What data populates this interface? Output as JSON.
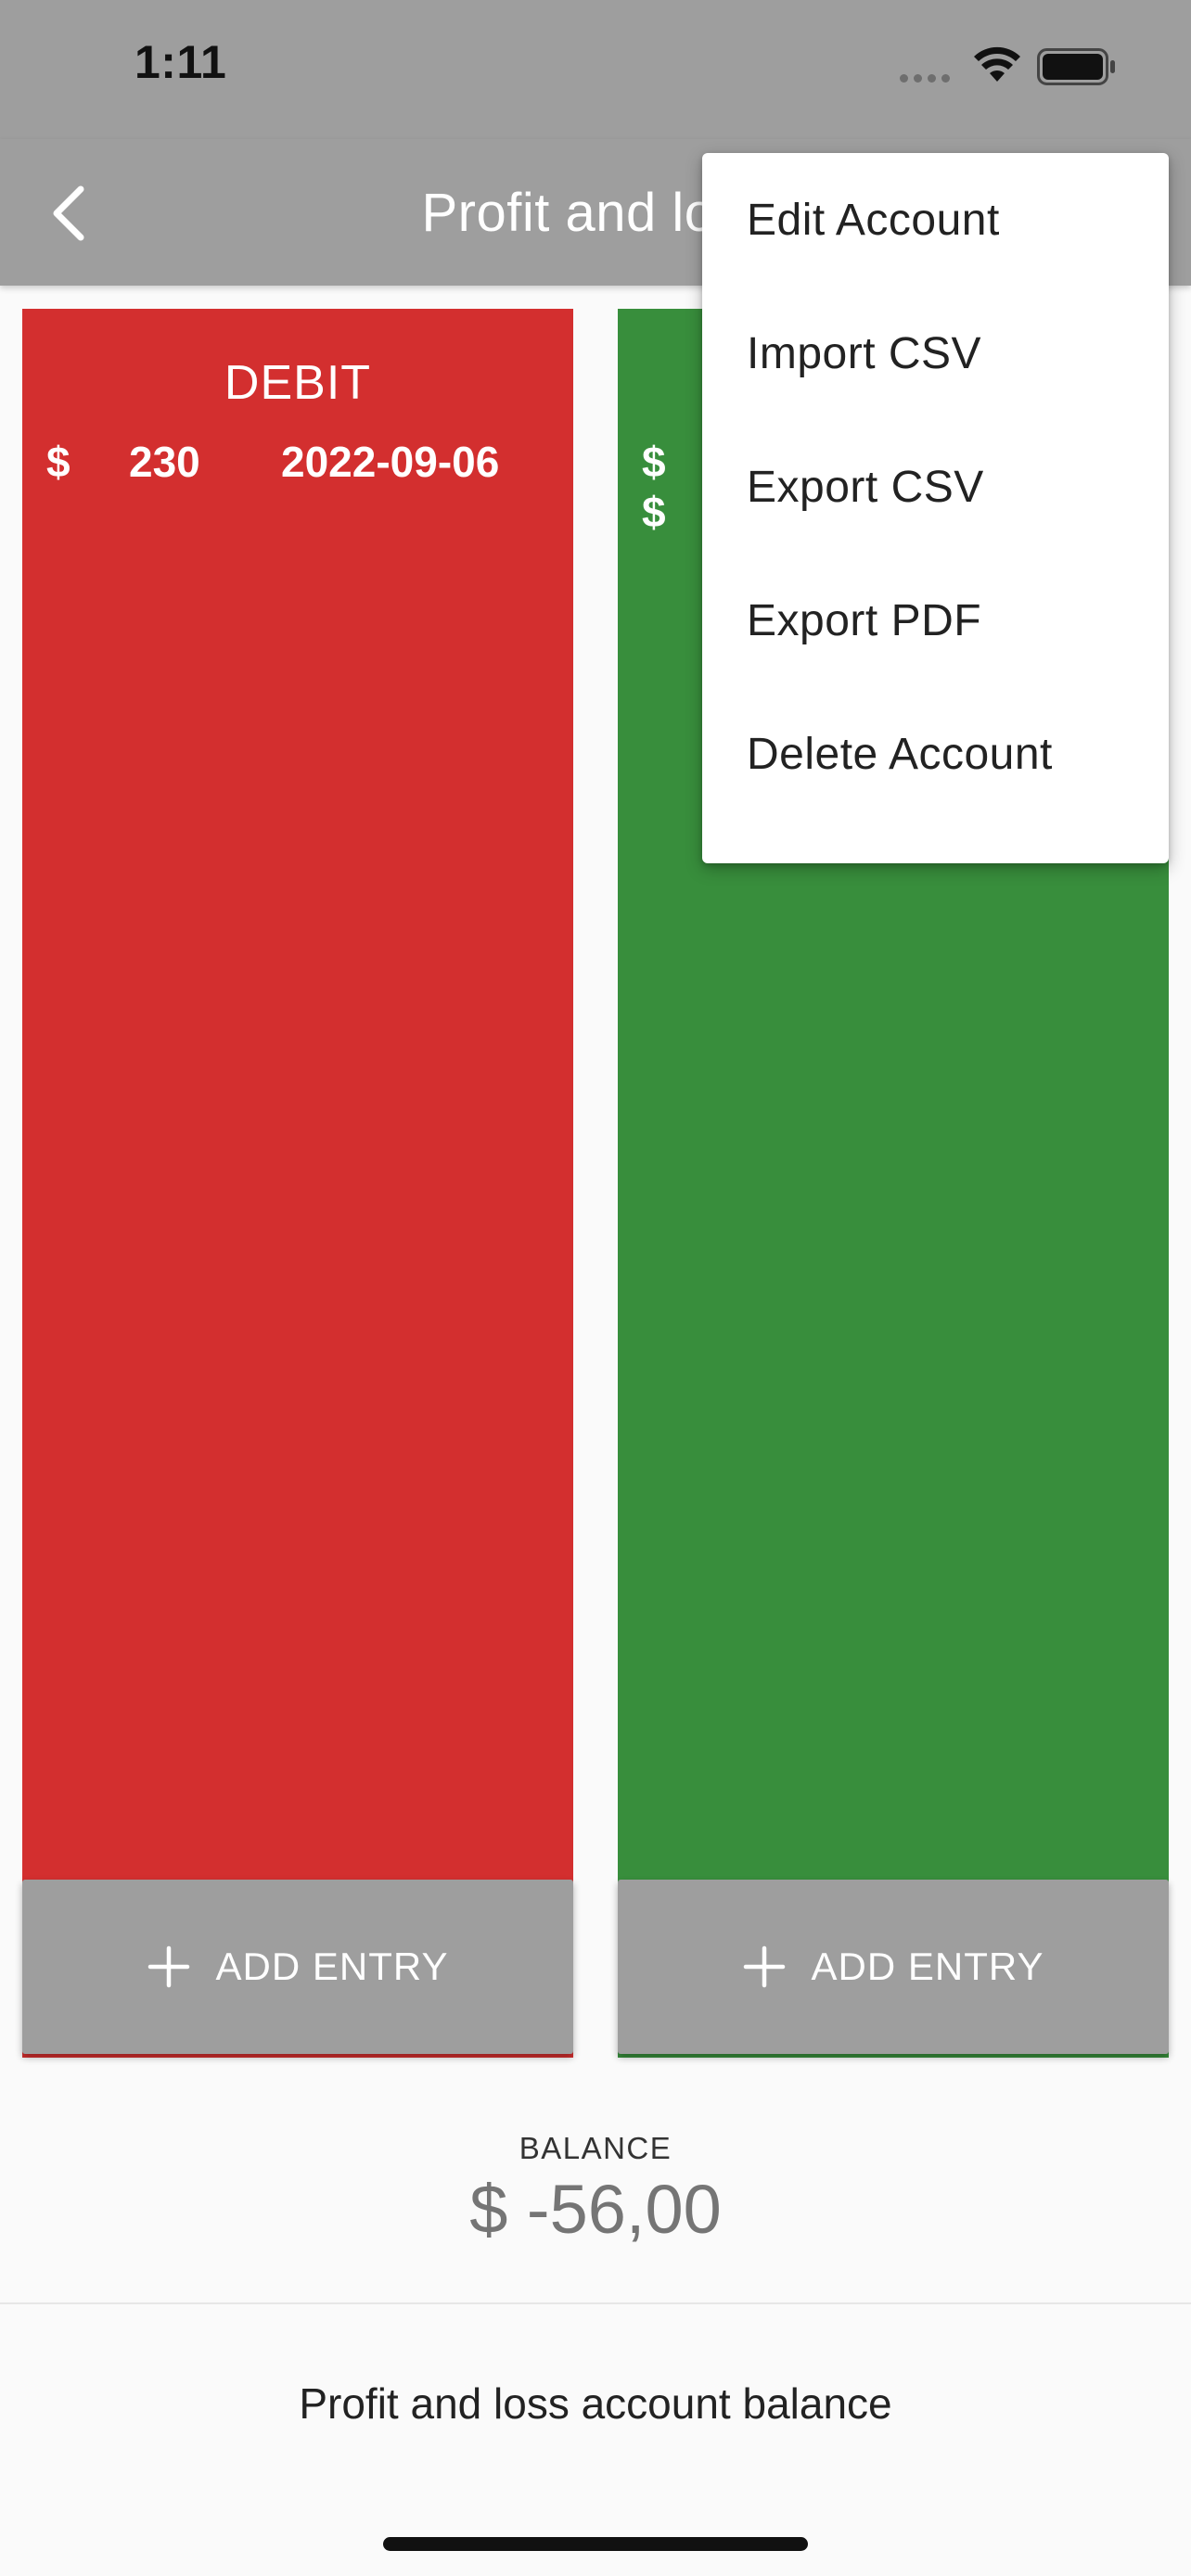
{
  "status_bar": {
    "time": "1:11"
  },
  "app_bar": {
    "title": "Profit and loss",
    "back_icon": "chevron-left-icon"
  },
  "debit_column": {
    "header": "DEBIT",
    "color": "#d32f2f",
    "entries": [
      {
        "currency": "$",
        "amount": "230",
        "date": "2022-09-06"
      }
    ],
    "add_entry_label": "ADD ENTRY"
  },
  "credit_column": {
    "color": "#388e3c",
    "entries": [
      {
        "currency": "$"
      },
      {
        "currency": "$"
      }
    ],
    "add_entry_label": "ADD ENTRY"
  },
  "balance": {
    "label": "BALANCE",
    "value": "$ -56,00"
  },
  "footer": {
    "text": "Profit and loss account balance"
  },
  "menu": {
    "items": [
      {
        "label": "Edit Account"
      },
      {
        "label": "Import CSV"
      },
      {
        "label": "Export CSV"
      },
      {
        "label": "Export PDF"
      },
      {
        "label": "Delete Account"
      }
    ]
  },
  "colors": {
    "app_bar": "#9e9e9e",
    "button": "#9e9e9e",
    "background": "#fafafa"
  }
}
